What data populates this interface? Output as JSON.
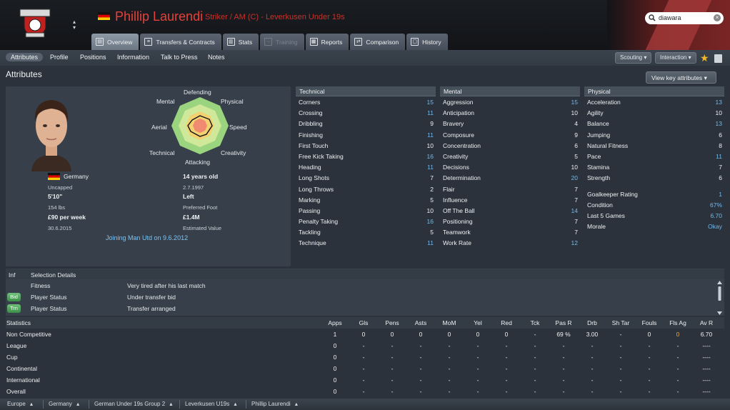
{
  "header": {
    "player_name": "Phillip Laurendi",
    "player_subtitle": "Striker / AM (C) - Leverkusen Under 19s",
    "crest_icon": "club-crest-icon",
    "accent_color": "#e8403a",
    "search": {
      "value": "diawara",
      "placeholder": "Search"
    }
  },
  "tabs": [
    {
      "label": "Overview",
      "icon": "overview-icon"
    },
    {
      "label": "Transfers & Contracts",
      "icon": "contract-icon"
    },
    {
      "label": "Stats",
      "icon": "stats-icon"
    },
    {
      "label": "Training",
      "icon": "training-icon"
    },
    {
      "label": "Reports",
      "icon": "report-icon"
    },
    {
      "label": "Comparison",
      "icon": "comparison-icon"
    },
    {
      "label": "History",
      "icon": "history-icon"
    }
  ],
  "subnav": {
    "items": [
      "Attributes",
      "Profile",
      "Positions",
      "Information",
      "Talk to Press",
      "Notes"
    ],
    "scouting": "Scouting",
    "interaction": "Interaction"
  },
  "page": {
    "title": "Attributes",
    "view_key_btn": "View key attributes"
  },
  "radar_labels": {
    "defending": "Defending",
    "physical": "Physical",
    "speed": "Speed",
    "creativity": "Creativity",
    "attacking": "Attacking",
    "technical": "Technical",
    "aerial": "Aerial",
    "mental": "Mental"
  },
  "profile": {
    "nationality": "Germany",
    "caps": "Uncapped",
    "height": "5'10\"",
    "weight": "154 lbs",
    "wage": "£90 per week",
    "contract_end": "30.6.2015",
    "age": "14 years old",
    "dob": "2.7.1997",
    "foot": "Left",
    "foot_label": "Preferred Foot",
    "value": "£1.4M",
    "value_label": "Estimated Value",
    "joining": "Joining Man Utd on 9.6.2012"
  },
  "technical": {
    "header": "Technical",
    "rows": [
      {
        "name": "Corners",
        "value": "15",
        "blue": true
      },
      {
        "name": "Crossing",
        "value": "11",
        "blue": true
      },
      {
        "name": "Dribbling",
        "value": "9",
        "blue": false
      },
      {
        "name": "Finishing",
        "value": "11",
        "blue": true
      },
      {
        "name": "First Touch",
        "value": "10",
        "blue": false
      },
      {
        "name": "Free Kick Taking",
        "value": "16",
        "blue": true
      },
      {
        "name": "Heading",
        "value": "11",
        "blue": true
      },
      {
        "name": "Long Shots",
        "value": "7",
        "blue": false
      },
      {
        "name": "Long Throws",
        "value": "2",
        "blue": false
      },
      {
        "name": "Marking",
        "value": "5",
        "blue": false
      },
      {
        "name": "Passing",
        "value": "10",
        "blue": false
      },
      {
        "name": "Penalty Taking",
        "value": "16",
        "blue": true
      },
      {
        "name": "Tackling",
        "value": "5",
        "blue": false
      },
      {
        "name": "Technique",
        "value": "11",
        "blue": true
      }
    ]
  },
  "mental": {
    "header": "Mental",
    "rows": [
      {
        "name": "Aggression",
        "value": "15",
        "blue": true
      },
      {
        "name": "Anticipation",
        "value": "10",
        "blue": false
      },
      {
        "name": "Bravery",
        "value": "4",
        "blue": false
      },
      {
        "name": "Composure",
        "value": "9",
        "blue": false
      },
      {
        "name": "Concentration",
        "value": "6",
        "blue": false
      },
      {
        "name": "Creativity",
        "value": "5",
        "blue": false
      },
      {
        "name": "Decisions",
        "value": "10",
        "blue": false
      },
      {
        "name": "Determination",
        "value": "20",
        "blue": true
      },
      {
        "name": "Flair",
        "value": "7",
        "blue": false
      },
      {
        "name": "Influence",
        "value": "7",
        "blue": false
      },
      {
        "name": "Off The Ball",
        "value": "14",
        "blue": true
      },
      {
        "name": "Positioning",
        "value": "7",
        "blue": false
      },
      {
        "name": "Teamwork",
        "value": "7",
        "blue": false
      },
      {
        "name": "Work Rate",
        "value": "12",
        "blue": true
      }
    ]
  },
  "physical": {
    "header": "Physical",
    "rows": [
      {
        "name": "Acceleration",
        "value": "13",
        "blue": true
      },
      {
        "name": "Agility",
        "value": "10",
        "blue": false
      },
      {
        "name": "Balance",
        "value": "13",
        "blue": true
      },
      {
        "name": "Jumping",
        "value": "6",
        "blue": false
      },
      {
        "name": "Natural Fitness",
        "value": "8",
        "blue": false
      },
      {
        "name": "Pace",
        "value": "11",
        "blue": true
      },
      {
        "name": "Stamina",
        "value": "7",
        "blue": false
      },
      {
        "name": "Strength",
        "value": "6",
        "blue": false
      }
    ],
    "extra": [
      {
        "name": "Goalkeeper Rating",
        "value": "1",
        "blue": true
      },
      {
        "name": "Condition",
        "value": "67%",
        "blue": true
      },
      {
        "name": "Last 5 Games",
        "value": "6.70",
        "blue": true
      },
      {
        "name": "Morale",
        "value": "Okay",
        "blue": true
      }
    ]
  },
  "selection": {
    "col1": "Inf",
    "col2": "Selection Details",
    "rows": [
      {
        "badge": "",
        "label": "Fitness",
        "detail": "Very tired after his last match"
      },
      {
        "badge": "Bid",
        "label": "Player Status",
        "detail": "Under transfer bid"
      },
      {
        "badge": "Trn",
        "label": "Player Status",
        "detail": "Transfer arranged"
      }
    ]
  },
  "stats": {
    "title": "Statistics",
    "columns": [
      "Apps",
      "Gls",
      "Pens",
      "Asts",
      "MoM",
      "Yel",
      "Red",
      "Tck",
      "Pas R",
      "Drb",
      "Sh Tar",
      "Fouls",
      "Fls Ag",
      "Av R"
    ],
    "rows": [
      {
        "label": "Non Competitive",
        "values": [
          "1",
          "0",
          "0",
          "0",
          "0",
          "0",
          "0",
          "-",
          "69 %",
          "3.00",
          "-",
          "0",
          "0",
          "6.70"
        ]
      },
      {
        "label": "League",
        "values": [
          "0",
          "-",
          "-",
          "-",
          "-",
          "-",
          "-",
          "-",
          "-",
          "-",
          "-",
          "-",
          "-",
          "----"
        ]
      },
      {
        "label": "Cup",
        "values": [
          "0",
          "-",
          "-",
          "-",
          "-",
          "-",
          "-",
          "-",
          "-",
          "-",
          "-",
          "-",
          "-",
          "----"
        ]
      },
      {
        "label": "Continental",
        "values": [
          "0",
          "-",
          "-",
          "-",
          "-",
          "-",
          "-",
          "-",
          "-",
          "-",
          "-",
          "-",
          "-",
          "----"
        ]
      },
      {
        "label": "International",
        "values": [
          "0",
          "-",
          "-",
          "-",
          "-",
          "-",
          "-",
          "-",
          "-",
          "-",
          "-",
          "-",
          "-",
          "----"
        ]
      },
      {
        "label": "Overall",
        "values": [
          "0",
          "-",
          "-",
          "-",
          "-",
          "-",
          "-",
          "-",
          "-",
          "-",
          "-",
          "-",
          "-",
          "----"
        ]
      }
    ]
  },
  "footer": [
    "Europe",
    "Germany",
    "German Under 19s Group 2",
    "Leverkusen U19s",
    "Phillip Laurendi"
  ]
}
